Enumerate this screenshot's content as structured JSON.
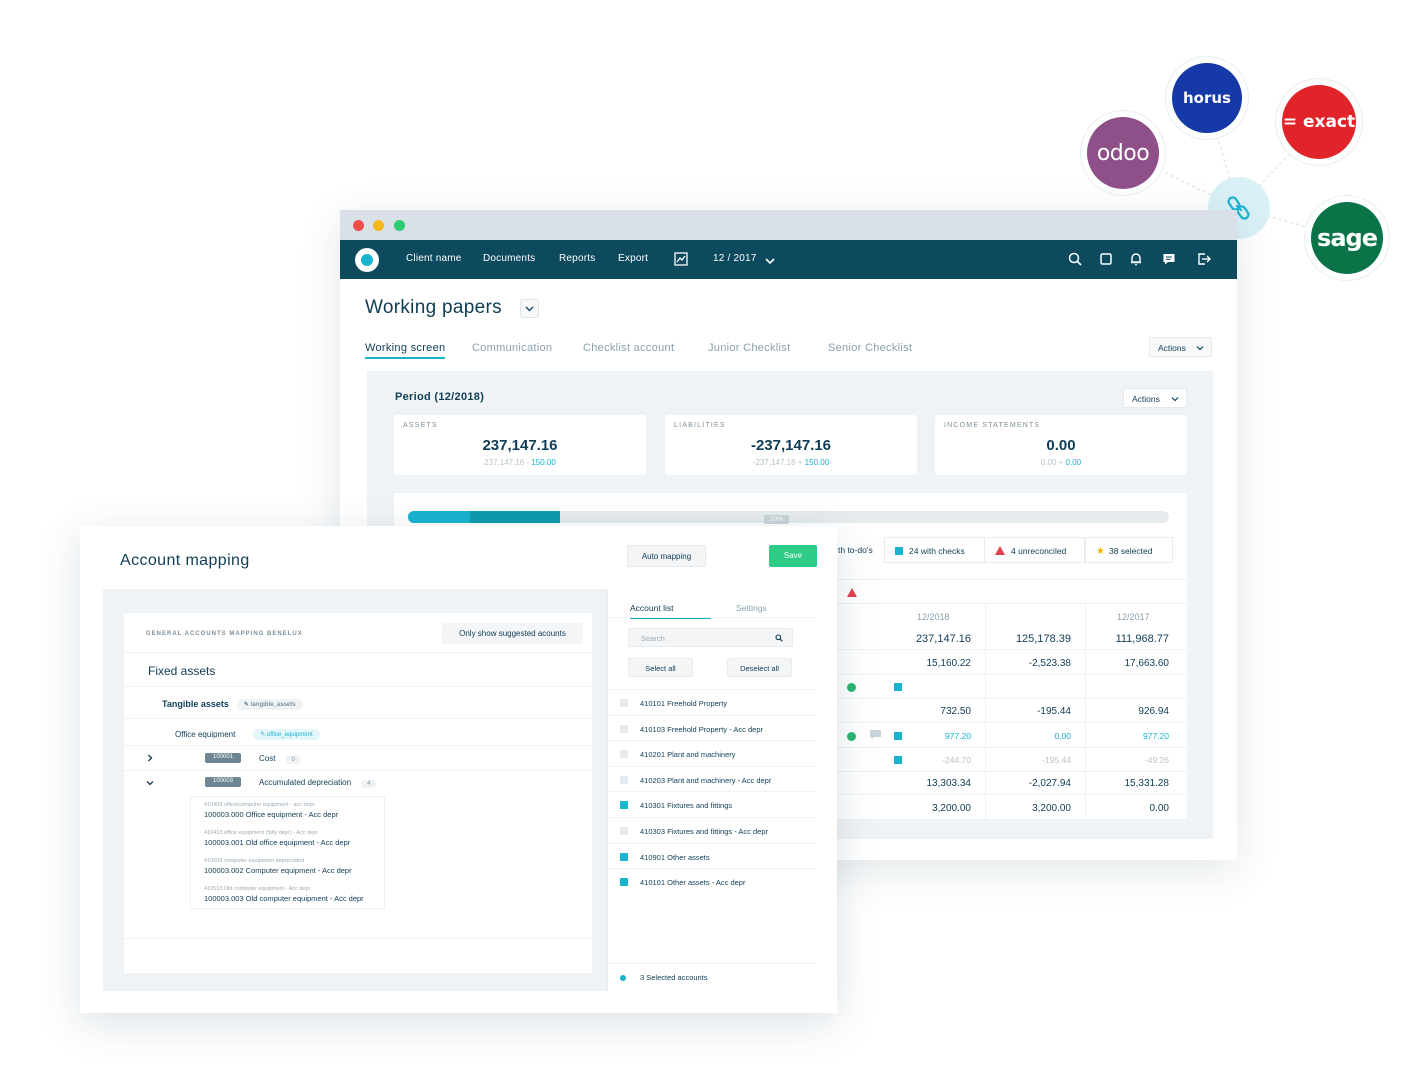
{
  "integrations": {
    "logos": [
      {
        "name": "odoo",
        "text": "odoo",
        "color": "#8f5089"
      },
      {
        "name": "horus",
        "text": "horus",
        "color": "#1639a8"
      },
      {
        "name": "exact",
        "text": "= exact",
        "color": "#e1242a"
      },
      {
        "name": "sage",
        "text": "sage",
        "color": "#0b7348"
      }
    ],
    "hub_icon": "link-icon"
  },
  "back_window": {
    "nav": {
      "items": [
        "Client name",
        "Documents",
        "Reports",
        "Export"
      ],
      "period": "12 / 2017",
      "icons": [
        "chart-icon",
        "search-icon",
        "square-icon",
        "bell-icon",
        "chat-icon",
        "logout-icon"
      ]
    },
    "title": "Working papers",
    "tabs": [
      "Working screen",
      "Communication",
      "Checklist account",
      "Junior Checklist",
      "Senior Checklist"
    ],
    "actions_label": "Actions",
    "period_title": "Period (12/2018)",
    "period_actions_label": "Actions",
    "stats": [
      {
        "label": "ASSETS",
        "value": "237,147.16",
        "sub_a": "237,147.16 - ",
        "sub_b": "150.00"
      },
      {
        "label": "LIABILITIES",
        "value": "-237,147.16",
        "sub_a": "-237,147.16 + ",
        "sub_b": "150.00"
      },
      {
        "label": "INCOME STATEMENTS",
        "value": "0.00",
        "sub_a": "0.00 + ",
        "sub_b": "0.00"
      }
    ],
    "progress": {
      "value": 0.2,
      "label": "20%"
    },
    "filters": [
      "th to-do's",
      "24 with checks",
      "4 unreconciled",
      "38 selected"
    ],
    "columns": [
      "12/2018",
      "12/2017"
    ],
    "rows": [
      {
        "c1": "237,147.16",
        "c2": "125,178.39",
        "c3": "111,968.77",
        "style": "big"
      },
      {
        "c1": "15,160.22",
        "c2": "-2,523.38",
        "c3": "17,663.60",
        "style": ""
      },
      {
        "c1": "",
        "c2": "",
        "c3": "",
        "style": ""
      },
      {
        "c1": "732.50",
        "c2": "-195.44",
        "c3": "926.94",
        "style": ""
      },
      {
        "c1": "977.20",
        "c2": "0.00",
        "c3": "977.20",
        "style": "blue"
      },
      {
        "c1": "-244.70",
        "c2": "-195.44",
        "c3": "-49.26",
        "style": "muted"
      },
      {
        "c1": "13,303.34",
        "c2": "-2,027.94",
        "c3": "15,331.28",
        "style": ""
      },
      {
        "c1": "3,200.00",
        "c2": "3,200.00",
        "c3": "0.00",
        "style": ""
      }
    ]
  },
  "front_window": {
    "title": "Account mapping",
    "auto_mapping": "Auto mapping",
    "save": "Save",
    "tree": {
      "header": "GENERAL ACCOUNTS MAPPING BENELUX",
      "suggested_btn": "Only show suggested acounts",
      "group": "Fixed assets",
      "subgroup": "Tangible assets",
      "subgroup_tag": "tangible_assets",
      "category": "Office equipment",
      "category_tag": "office_equipment",
      "nodes": [
        {
          "code": "100001",
          "label": "Cost",
          "count": "0"
        },
        {
          "code": "100003",
          "label": "Accumulated depreciation",
          "count": "4"
        }
      ],
      "mapped": [
        {
          "small": "410403 office/computer equipment - acc depr",
          "main": "100003.000 Office equipment - Acc depr"
        },
        {
          "small": "410413 office equipment (fully depr) - Acc depr",
          "main": "100003.001 Old office equipment - Acc depr"
        },
        {
          "small": "410503 computer equipment depreciated",
          "main": "100003.002 Computer equipment - Acc depr"
        },
        {
          "small": "410513 Old computer equipment - Acc depr",
          "main": "100003.003 Old computer equipment - Acc depr"
        }
      ]
    },
    "accounts": {
      "tabs": [
        "Account list",
        "Settings"
      ],
      "search_placeholder": "Search",
      "select_all": "Select all",
      "deselect_all": "Deselect all",
      "items": [
        {
          "label": "410101 Freehold Property",
          "checked": false
        },
        {
          "label": "410103 Freehold Property - Acc depr",
          "checked": false
        },
        {
          "label": "410201 Plant and machinery",
          "checked": false
        },
        {
          "label": "410203 Plant and machinery - Acc depr",
          "checked": false
        },
        {
          "label": "410301 Fixtures and fittings",
          "checked": true
        },
        {
          "label": "410303 Fixtures and fittings - Acc depr",
          "checked": false
        },
        {
          "label": "410901 Other assets",
          "checked": true
        },
        {
          "label": "410101 Other assets - Acc depr",
          "checked": true
        }
      ],
      "footer": "3 Selected accounts"
    }
  }
}
